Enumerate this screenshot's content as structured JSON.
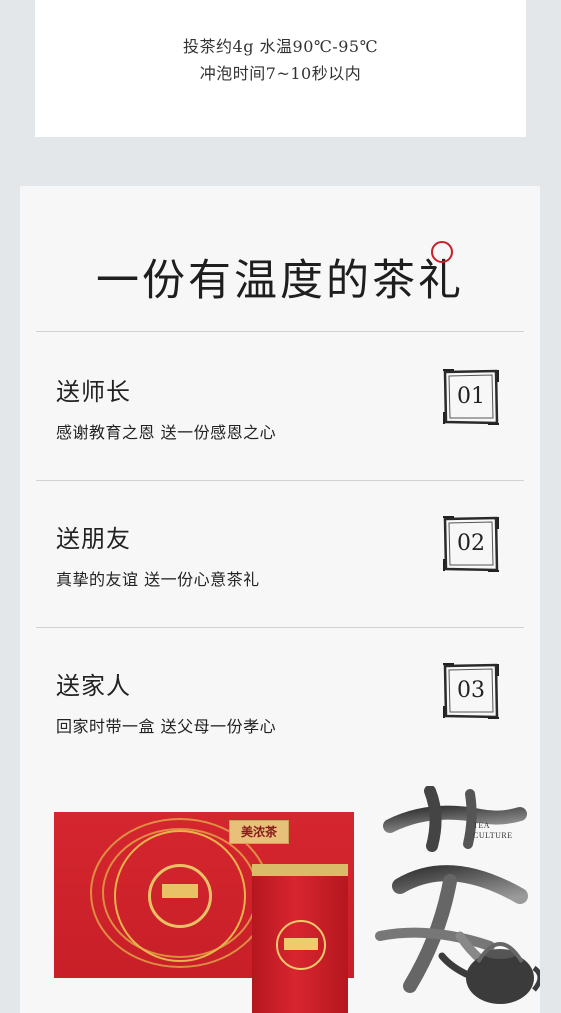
{
  "top_card": {
    "line1": "投茶约4g  水温90℃-95℃",
    "line2": "冲泡时间7~10秒以内"
  },
  "main": {
    "headline": "一份有温度的茶礼",
    "items": [
      {
        "title": "送师长",
        "desc": "感谢教育之恩  送一份感恩之心",
        "number": "01"
      },
      {
        "title": "送朋友",
        "desc": "真挚的友谊  送一份心意茶礼",
        "number": "02"
      },
      {
        "title": "送家人",
        "desc": "回家时带一盒  送父母一份孝心",
        "number": "03"
      }
    ]
  },
  "product": {
    "brand_tag": "美浓茶",
    "tea_culture_line1": "TEA",
    "tea_culture_line2": "CULTURE"
  },
  "colors": {
    "accent_red": "#c8202b",
    "gold": "#e7b54b",
    "card_bg": "#f7f7f7",
    "page_bg": "#e3e7ea"
  },
  "icons": [
    "number-frame-icon",
    "tea-calligraphy-icon",
    "teapot-icon"
  ]
}
